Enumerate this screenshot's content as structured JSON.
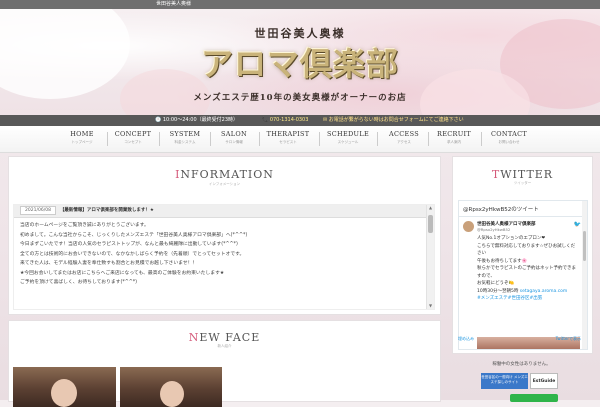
{
  "topbar": {
    "text": "世田谷美人奥様"
  },
  "hero": {
    "subtitle": "世田谷美人奥様",
    "title": "アロマ倶楽部",
    "tagline": "メンズエステ歴10年の美女奥様がオーナーのお店"
  },
  "infobar": {
    "hours": "🕙 10:00〜24:00（最終受付23時）",
    "tel": "📞 070-1314-0303",
    "note": "✉ お電話が繋がらない時はお問合せフォームにてご連絡下さい"
  },
  "nav": [
    {
      "en": "HOME",
      "ja": "トップページ"
    },
    {
      "en": "CONCEPT",
      "ja": "コンセプト"
    },
    {
      "en": "SYSTEM",
      "ja": "料金システム"
    },
    {
      "en": "SALON",
      "ja": "サロン情報"
    },
    {
      "en": "THERAPIST",
      "ja": "セラピスト"
    },
    {
      "en": "SCHEDULE",
      "ja": "スケジュール"
    },
    {
      "en": "ACCESS",
      "ja": "アクセス"
    },
    {
      "en": "RECRUIT",
      "ja": "求人案内"
    },
    {
      "en": "CONTACT",
      "ja": "お問い合わせ"
    }
  ],
  "information": {
    "cap": "I",
    "rest": "NFORMATION",
    "sub": "インフォメーション",
    "date": "2021/06/08",
    "headline": "【最新情報】アロマ倶楽部を開業致します！★",
    "lines": [
      "当店のホームページをご覧頂き誠にありがとうございます。",
      "初めまして。こんな当社からこそ、じっくりしたメンズエステ「世田谷美人奥様アロマ倶楽部」へ(*^^*)",
      "今日まずこいたです！当店の人気のセラピストトップが、なんと最も綺麗隊に出動しています(*^^*)",
      "全ての方とは技術的にお会いできないので、なかなかしばらく予約を（先着順）でとってセットオです。",
      "来てきた人は、モデル経験人妻を奉仕致すも割合とお見積でお越し下さいませ！！",
      "★今回お会いしてまたはお店にこちらへご来店になっても、最高のご体験をお約束いたします★",
      "ご予約を頂けて喜ばしく、お待ちしております(*^^*)"
    ]
  },
  "newface": {
    "cap": "N",
    "rest": "EW FACE",
    "sub": "新人紹介"
  },
  "twitter": {
    "title": "TWITTER",
    "sub": "ツイッター",
    "header": "@Rpsx2yHkwB52のツイート",
    "name": "世田谷美人奥様アロマ倶楽部",
    "handle": "@Rpsx2yHkwB52",
    "text1": "人気No.1オプションのエプロン❤",
    "text2": "こちらで無料対応しております☆ぜひお試しください",
    "text3": "午後もお待ちしてます🌸",
    "text4": "秋らかでセラピストのご予約はネット予約できますので、",
    "text5": "お気軽にどうぞ🍋",
    "text6": "10時30分〜翌朝5時",
    "link": "setagaya.aroma.com",
    "text7": "#メンズエステ#世田谷区#出張",
    "embed": "埋め込み",
    "view_on": "Twitterで表示"
  },
  "caption": "稼働中の女性はありません。",
  "banner1": "世田谷区の一般向け\nメンズエステ探しのサイト",
  "banner2": "EstGuide"
}
